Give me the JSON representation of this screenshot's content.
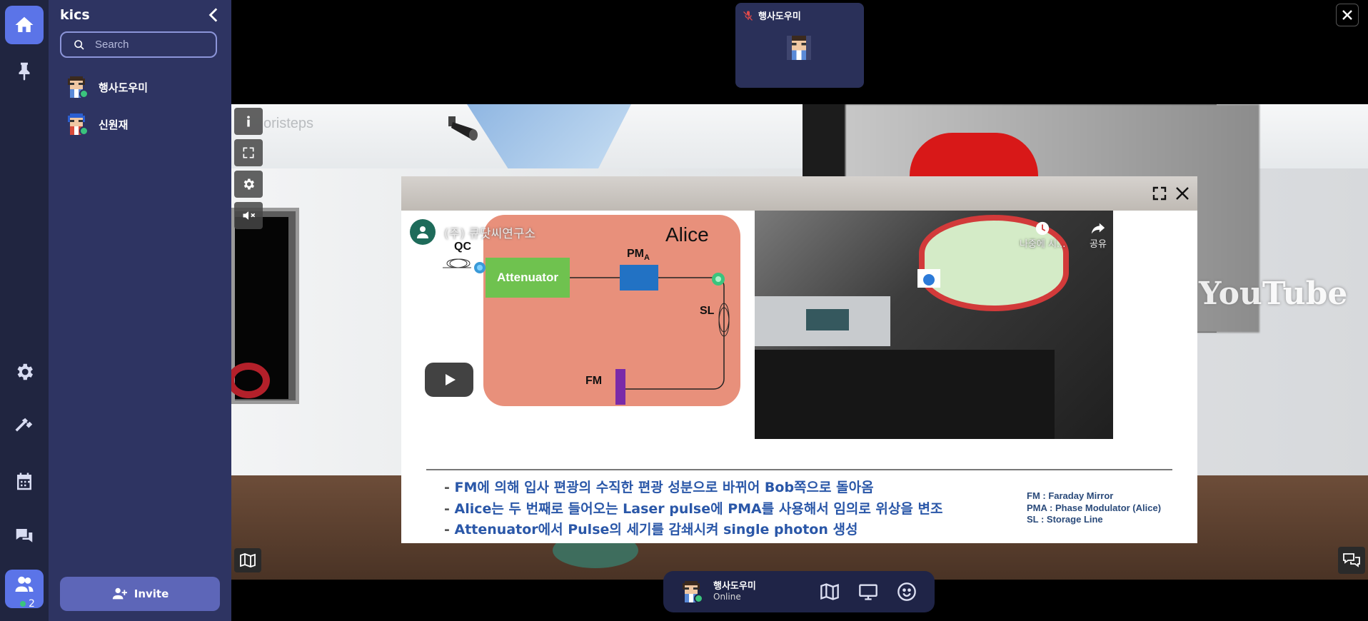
{
  "workspace": {
    "title": "kics"
  },
  "search": {
    "placeholder": "Search"
  },
  "members": [
    {
      "name": "행사도우미",
      "status_color": "#3ac47d"
    },
    {
      "name": "신원재",
      "status_color": "#3ac47d"
    }
  ],
  "rail": {
    "people_count": "2"
  },
  "invite": {
    "label": "Invite"
  },
  "speaker_tile": {
    "name": "행사도우미"
  },
  "me": {
    "name": "행사도우미",
    "status": "Online"
  },
  "stage": {
    "brand_ghost": "oristeps",
    "youtube_wall_text": "YouTube"
  },
  "video": {
    "channel": "(주) 큐닷씨연구소",
    "watch_later": "나중에 시...",
    "share": "공유",
    "slide": {
      "alice": "Alice",
      "qc": "QC",
      "attenuator": "Attenuator",
      "pm": "PM",
      "pm_sub": "A",
      "sl": "SL",
      "fm": "FM",
      "bullets": [
        "FM에 의해 입사 편광의 수직한 편광 성분으로 바뀌어 Bob쪽으로 돌아옴",
        "Alice는 두 번째로 들어오는 Laser pulse에 PMA를 사용해서 임의로 위상을 변조",
        "Attenuator에서 Pulse의 세기를 감쇄시켜 single photon 생성"
      ],
      "legend": [
        "FM : Faraday Mirror",
        "PMA : Phase Modulator (Alice)",
        "SL :  Storage Line"
      ]
    }
  },
  "colors": {
    "accent": "#5b74e8",
    "panel": "#2e3462",
    "rail": "#202540",
    "online": "#3ac47d"
  }
}
